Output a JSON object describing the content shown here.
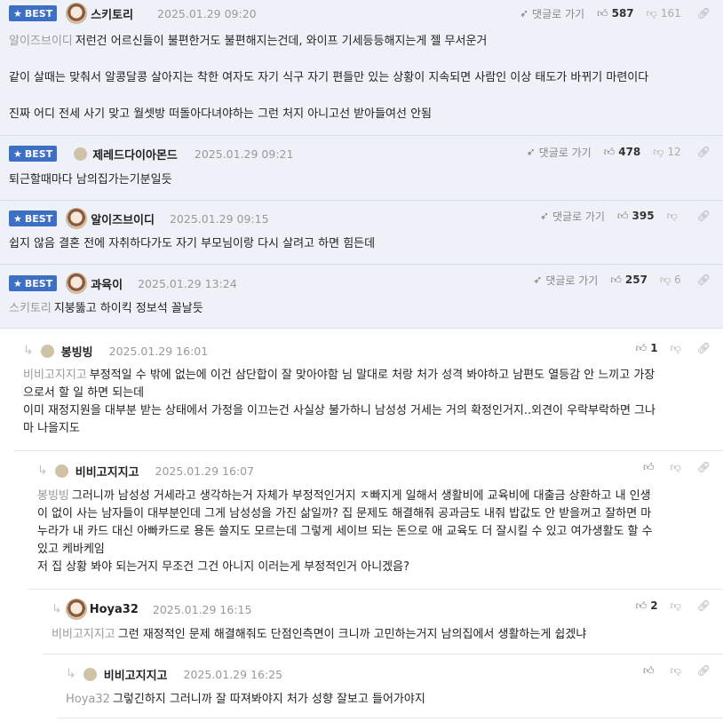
{
  "ui": {
    "best_label": "BEST",
    "reply_link": "댓글로 가기"
  },
  "comments": [
    {
      "nick": "스키토리",
      "date": "2025.01.29 09:20",
      "up": "587",
      "down": "161",
      "mention": "알이즈브이디",
      "paragraphs": [
        "저런건 어르신들이 불편한거도 불편해지는건데, 와이프 기세등등해지는게 젤 무서운거",
        "같이 살때는 맞춰서 알콩달콩 살아지는 착한 여자도 자기 식구 자기 편들만 있는 상황이 지속되면 사람인 이상 태도가 바뀌기 마련이다",
        "진짜 어디 전세 사기 맞고 월셋방 떠돌아다녀야하는 그런 처지 아니고선 받아들여선 안됨"
      ]
    },
    {
      "nick": "제레드다이아몬드",
      "date": "2025.01.29 09:21",
      "up": "478",
      "down": "12",
      "paragraphs": [
        "퇴근할때마다 남의집가는기분일듯"
      ]
    },
    {
      "nick": "알이즈브이디",
      "date": "2025.01.29 09:15",
      "up": "395",
      "down": "",
      "paragraphs": [
        "쉽지 않음 결혼 전에 자취하다가도 자기 부모님이랑 다시 살려고 하면 힘든데"
      ]
    },
    {
      "nick": "과육이",
      "date": "2025.01.29 13:24",
      "up": "257",
      "down": "6",
      "mention": "스키토리",
      "paragraphs": [
        "지붕뚫고 하이킥 정보석 꼴날듯"
      ]
    },
    {
      "nick": "봉빙빙",
      "date": "2025.01.29 16:01",
      "up": "1",
      "down": "",
      "mention": "비비고지지고",
      "lines": [
        "부정적일 수 밖에 없는에 이건 삼단합이 잘 맞아야함 님 말대로 처랑 처가 성격 봐야하고 남편도 열등감 안 느끼고 가장",
        "으로서 할 일 하면 되는데",
        "이미 재정지원을 대부분 받는 상태에서 가정을 이끄는건 사실상 불가하니 남성성 거세는 거의 확정인거지..외견이 우락부락하면 그나",
        "마 나을지도"
      ]
    },
    {
      "nick": "비비고지지고",
      "date": "2025.01.29 16:07",
      "up": "",
      "down": "",
      "mention": "봉빙빙",
      "lines": [
        "그러니까 남성성 거세라고 생각하는거 자체가 부정적인거지 ㅈ빠지게 일해서 생활비에 교육비에 대출금 상환하고 내 인생",
        "이 없이 사는 남자들이 대부분인데 그게 남성성을 가진 삶일까? 집 문제도 해결해줘 공과금도 내줘 밥값도 안 받을꺼고 잘하면 마",
        "누라가 내 카드 대신 아빠카드로 용돈 쓸지도 모르는데 그렇게 세이브 되는 돈으로 애 교육도 더 잘시킬 수 있고 여가생활도 할 수",
        "있고 케바케임",
        "저 집 상황 봐야 되는거지 무조건 그건 아니지 이러는게 부정적인거 아니겠음?"
      ]
    },
    {
      "nick": "Hoya32",
      "date": "2025.01.29 16:15",
      "up": "2",
      "down": "",
      "mention": "비비고지지고",
      "lines": [
        "그런 재정적인 문제 해결해줘도 단점인측면이 크니까 고민하는거지 남의집에서 생활하는게 쉽겠냐"
      ]
    },
    {
      "nick": "비비고지지고",
      "date": "2025.01.29 16:25",
      "up": "",
      "down": "",
      "mention": "Hoya32",
      "lines": [
        "그렇긴하지 그러니까 잘 따져봐야지 처가 성향 잘보고 들어가야지"
      ]
    }
  ],
  "icons": {
    "reply_link": "send-icon",
    "up": "thumbs-up-icon",
    "down": "thumbs-down-icon",
    "link": "link-icon",
    "reply_arrow": "reply-arrow-icon",
    "best": "star-icon"
  },
  "colors": {
    "best_badge": "#3d6fc4",
    "best_bg": "#eef2f8",
    "mention": "#9a9a9a"
  }
}
